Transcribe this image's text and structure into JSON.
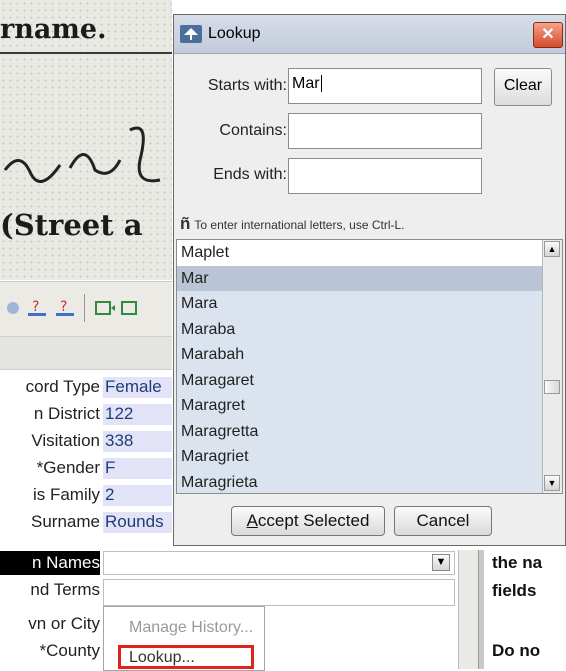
{
  "background_doc": {
    "heading_fragment": "rname.",
    "street_fragment": "(Street a"
  },
  "form": {
    "rows": [
      {
        "label": "cord Type",
        "value": "Female"
      },
      {
        "label": "n District",
        "value": "122"
      },
      {
        "label": "Visitation",
        "value": "338"
      },
      {
        "label": "*Gender",
        "value": "F"
      },
      {
        "label": "is Family",
        "value": "2"
      },
      {
        "label": "Surname",
        "value": "Rounds"
      },
      {
        "label": "n Names",
        "value": ""
      },
      {
        "label": "nd Terms",
        "value": ""
      },
      {
        "label": "vn or City",
        "value": ""
      },
      {
        "label": "*County",
        "value": ""
      }
    ]
  },
  "dropdown": {
    "items": [
      "Manage History...",
      "Lookup..."
    ]
  },
  "right_pane": {
    "lines": [
      "the na",
      "fields",
      "",
      "Do no"
    ]
  },
  "dialog": {
    "title": "Lookup",
    "close_glyph": "✕",
    "starts_with_label": "Starts with:",
    "starts_with_value": "Mar",
    "contains_label": "Contains:",
    "contains_value": "",
    "ends_with_label": "Ends with:",
    "ends_with_value": "",
    "clear_label": "Clear",
    "intl_glyph": "ñ",
    "intl_hint": "To enter international letters, use Ctrl-L.",
    "list_items": [
      "Maplet",
      "Mar",
      "Mara",
      "Maraba",
      "Marabah",
      "Maragaret",
      "Maragret",
      "Maragretta",
      "Maragriet",
      "Maragrieta"
    ],
    "selected_item": "Mar",
    "accept_label": "Accept Selected",
    "cancel_label": "Cancel"
  }
}
